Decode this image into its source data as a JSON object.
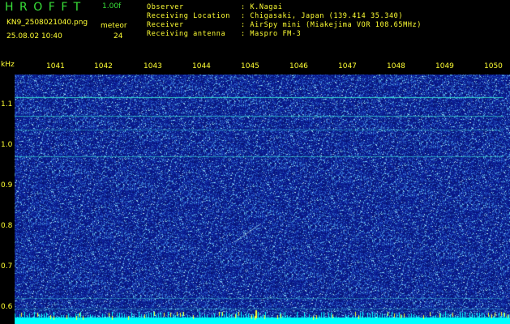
{
  "header": {
    "app_title": "HROFFT",
    "version": "1.00f",
    "filename": "KN9_2508021040.png",
    "mode": "meteor",
    "datetime": "25.08.02 10:40",
    "count": "24",
    "info": [
      {
        "label": "Observer",
        "value": ": K.Nagai"
      },
      {
        "label": "Receiving Location",
        "value": ": Chigasaki, Japan (139.414 35.340)"
      },
      {
        "label": "Receiver",
        "value": ": AirSpy mini (Miakejima VOR 108.65MHz)"
      },
      {
        "label": "Receiving antenna",
        "value": ": Maspro FM-3"
      }
    ]
  },
  "axes": {
    "y_unit": "kHz",
    "x_ticks": [
      "1041",
      "1042",
      "1043",
      "1044",
      "1045",
      "1046",
      "1047",
      "1048",
      "1049",
      "1050"
    ],
    "y_ticks": [
      "1.1",
      "1.0",
      "0.9",
      "0.8",
      "0.7",
      "0.6"
    ]
  },
  "colors": {
    "background": "#000000",
    "label": "#ffff33",
    "title": "#38e038",
    "spectrogram_base": "#081a7a",
    "carrier_line": "#35e0d0",
    "floor": "#00ffff"
  }
}
